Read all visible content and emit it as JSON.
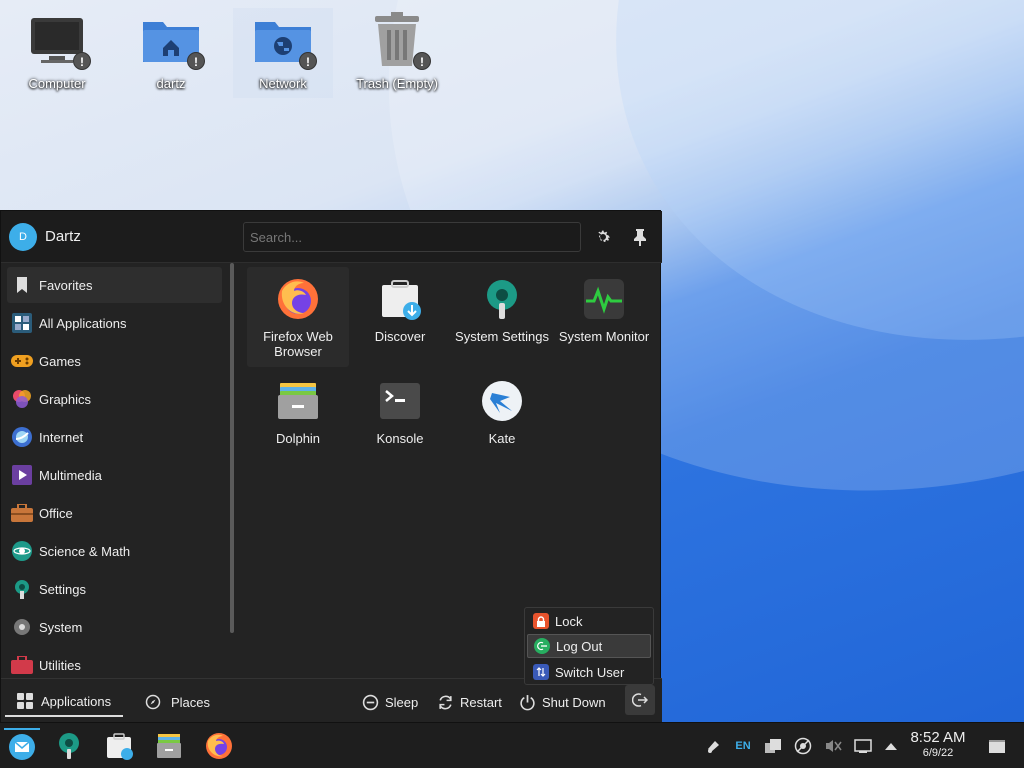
{
  "desktop": {
    "icons": [
      {
        "label": "Computer",
        "icon": "computer-icon"
      },
      {
        "label": "dartz",
        "icon": "home-folder-icon"
      },
      {
        "label": "Network",
        "icon": "network-folder-icon"
      },
      {
        "label": "Trash (Empty)",
        "icon": "trash-icon"
      }
    ],
    "badge_symbol": "!"
  },
  "menu": {
    "user": {
      "initial": "D",
      "name": "Dartz"
    },
    "search_placeholder": "Search...",
    "categories": [
      {
        "label": "Favorites",
        "icon": "bookmark-icon",
        "active": true
      },
      {
        "label": "All Applications",
        "icon": "all-apps-icon"
      },
      {
        "label": "Games",
        "icon": "games-icon"
      },
      {
        "label": "Graphics",
        "icon": "graphics-icon"
      },
      {
        "label": "Internet",
        "icon": "internet-icon"
      },
      {
        "label": "Multimedia",
        "icon": "multimedia-icon"
      },
      {
        "label": "Office",
        "icon": "office-icon"
      },
      {
        "label": "Science & Math",
        "icon": "science-icon"
      },
      {
        "label": "Settings",
        "icon": "settings-icon"
      },
      {
        "label": "System",
        "icon": "system-icon"
      },
      {
        "label": "Utilities",
        "icon": "utilities-icon"
      }
    ],
    "apps": [
      {
        "label": "Firefox Web Browser",
        "icon": "firefox-icon"
      },
      {
        "label": "Discover",
        "icon": "discover-icon"
      },
      {
        "label": "System Settings",
        "icon": "system-settings-icon"
      },
      {
        "label": "System Monitor",
        "icon": "system-monitor-icon"
      },
      {
        "label": "Dolphin",
        "icon": "dolphin-icon"
      },
      {
        "label": "Konsole",
        "icon": "konsole-icon"
      },
      {
        "label": "Kate",
        "icon": "kate-icon"
      }
    ],
    "footer": {
      "applications": "Applications",
      "places": "Places",
      "sleep": "Sleep",
      "restart": "Restart",
      "shutdown": "Shut Down"
    },
    "session": {
      "lock": "Lock",
      "logout": "Log Out",
      "switch_user": "Switch User"
    }
  },
  "taskbar": {
    "tasks": [
      "kickoff-icon",
      "system-settings-icon",
      "discover-icon",
      "dolphin-icon",
      "firefox-icon"
    ],
    "tray": {
      "keyboard_layout": "EN"
    },
    "clock": {
      "time": "8:52 AM",
      "date": "6/9/22"
    }
  },
  "colors": {
    "accent": "#3daee9",
    "panel": "#1e1e1e",
    "menu_bg": "#232323"
  }
}
